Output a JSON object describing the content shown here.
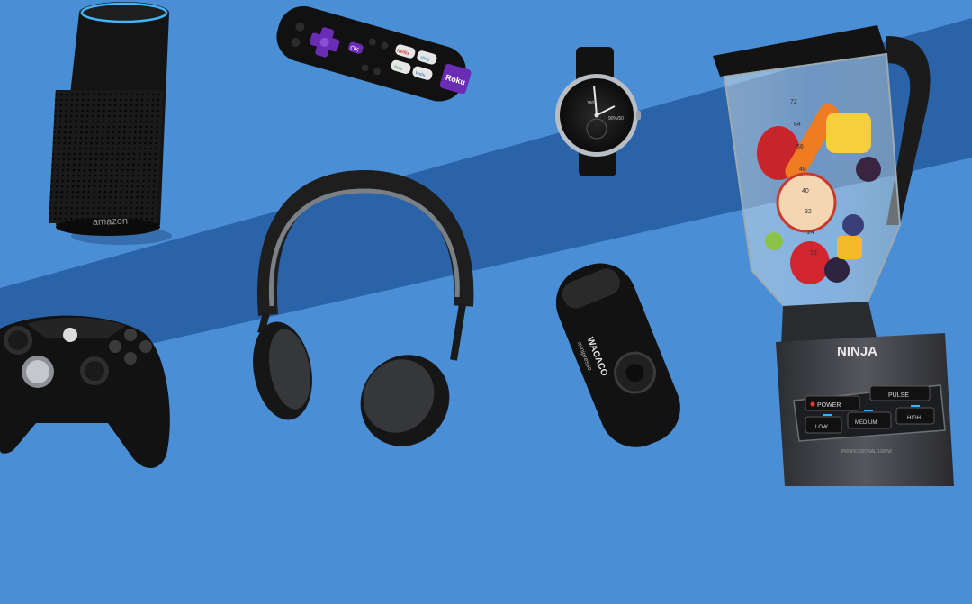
{
  "scene": {
    "colors": {
      "background": "#4a8fd6",
      "stripe": "#2a63a8",
      "device_black": "#141414",
      "roku_purple": "#6a2bb5",
      "echo_ring": "#3fb8ff"
    },
    "echo": {
      "brand": "amazon"
    },
    "remote": {
      "brand": "Roku",
      "ok_label": "OK",
      "buttons": [
        "Netflix",
        "sling",
        "hulu",
        "Vudu"
      ]
    },
    "watch": {
      "dial_left": "7803",
      "dial_right": "90%/50"
    },
    "espresso": {
      "brand": "WACACO",
      "model": "minipresso"
    },
    "blender": {
      "brand": "NINJA",
      "buttons": [
        "POWER",
        "PULSE",
        "LOW",
        "MEDIUM",
        "HIGH"
      ],
      "scale": [
        "72",
        "64",
        "56",
        "48",
        "40",
        "32",
        "24",
        "16"
      ],
      "base_text": "PROFESSIONAL 1000W"
    }
  }
}
